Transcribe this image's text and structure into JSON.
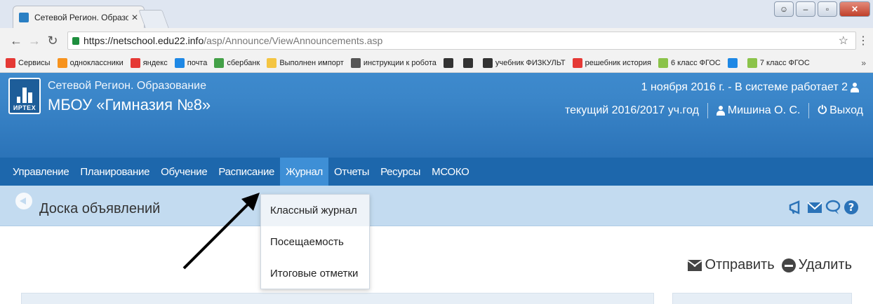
{
  "browser": {
    "tab_title": "Сетевой Регион. Образо",
    "tab_close": "✕",
    "url_host": "https://netschool.edu22.info",
    "url_path": "/asp/Announce/ViewAnnouncements.asp",
    "bookmarks": [
      {
        "label": "Сервисы",
        "icon": "apps-icon",
        "color": "#e53935"
      },
      {
        "label": "одноклассники",
        "icon": "ok-icon",
        "color": "#f7931e"
      },
      {
        "label": "яндекс",
        "icon": "yandex-icon",
        "color": "#e53935"
      },
      {
        "label": "почта",
        "icon": "mail-icon",
        "color": "#1e88e5"
      },
      {
        "label": "сбербанк",
        "icon": "sber-icon",
        "color": "#43a047"
      },
      {
        "label": "Выполнен импорт",
        "icon": "folder-icon",
        "color": "#f4c542"
      },
      {
        "label": "инструкции к робота",
        "icon": "robot-icon",
        "color": "#555555"
      },
      {
        "label": "",
        "icon": "circle-icon",
        "color": "#333333"
      },
      {
        "label": "",
        "icon": "circle-outline-icon",
        "color": "#333333"
      },
      {
        "label": "учебник ФИЗКУЛЬТ",
        "icon": "book-icon",
        "color": "#333333"
      },
      {
        "label": "решебник история",
        "icon": "plusminus-icon",
        "color": "#e53935"
      },
      {
        "label": "6 класс ФГОС",
        "icon": "globe-icon",
        "color": "#8bc34a"
      },
      {
        "label": "",
        "icon": "tool-icon",
        "color": "#1e88e5"
      },
      {
        "label": "7 класс ФГОС",
        "icon": "globe-icon",
        "color": "#8bc34a"
      }
    ],
    "bookmarks_more": "»"
  },
  "header": {
    "system_name": "Сетевой Регион. Образование",
    "school_name": "МБОУ «Гимназия №8»",
    "logo_text": "ИРТЕХ",
    "date_status": "1 ноября 2016 г. - В системе работает 2",
    "school_year": "текущий 2016/2017 уч.год",
    "user_name": "Мишина О. С.",
    "logout": "Выход"
  },
  "nav": {
    "items": [
      "Управление",
      "Планирование",
      "Обучение",
      "Расписание",
      "Журнал",
      "Отчеты",
      "Ресурсы",
      "МСОКО"
    ],
    "active": "Журнал"
  },
  "page": {
    "title": "Доска объявлений",
    "send": "Отправить",
    "delete": "Удалить"
  },
  "dropdown": {
    "items": [
      "Классный журнал",
      "Посещаемость",
      "Итоговые отметки"
    ]
  },
  "colors": {
    "header_blue": "#2b73b8",
    "nav_blue": "#1d67ac",
    "active_nav": "#3e8fd6",
    "title_bar": "#c3dbf0"
  }
}
